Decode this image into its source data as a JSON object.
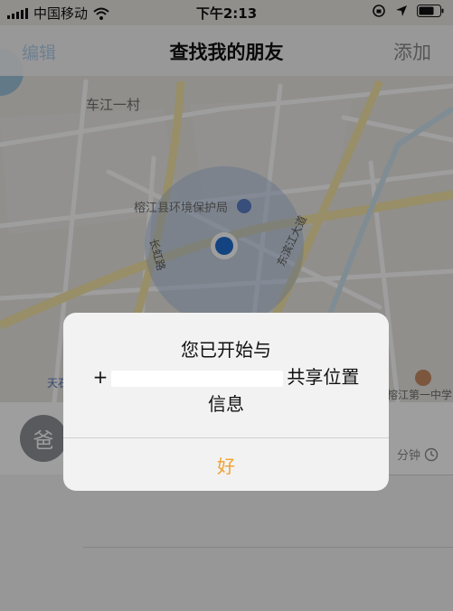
{
  "status_bar": {
    "carrier": "中国移动",
    "time": "下午2:13"
  },
  "nav": {
    "left_label": "编辑",
    "title": "查找我的朋友",
    "right_label": "添加"
  },
  "map": {
    "labels": {
      "village": "车江一村",
      "bureau": "榕江县环境保护局",
      "road_changhong": "长虹路",
      "road_dongbin": "东滨江大道",
      "left_edge": "天石",
      "school": "榕江第一中学"
    }
  },
  "friend": {
    "avatar_text": "爸",
    "meta_time": "分钟"
  },
  "alert": {
    "line1": "您已开始与",
    "prefix": "+",
    "line2_suffix": "共享位置",
    "line3": "信息",
    "button": "好"
  },
  "colors": {
    "accent_orange": "#f0a22e",
    "location_blue": "#1f6fd1"
  }
}
